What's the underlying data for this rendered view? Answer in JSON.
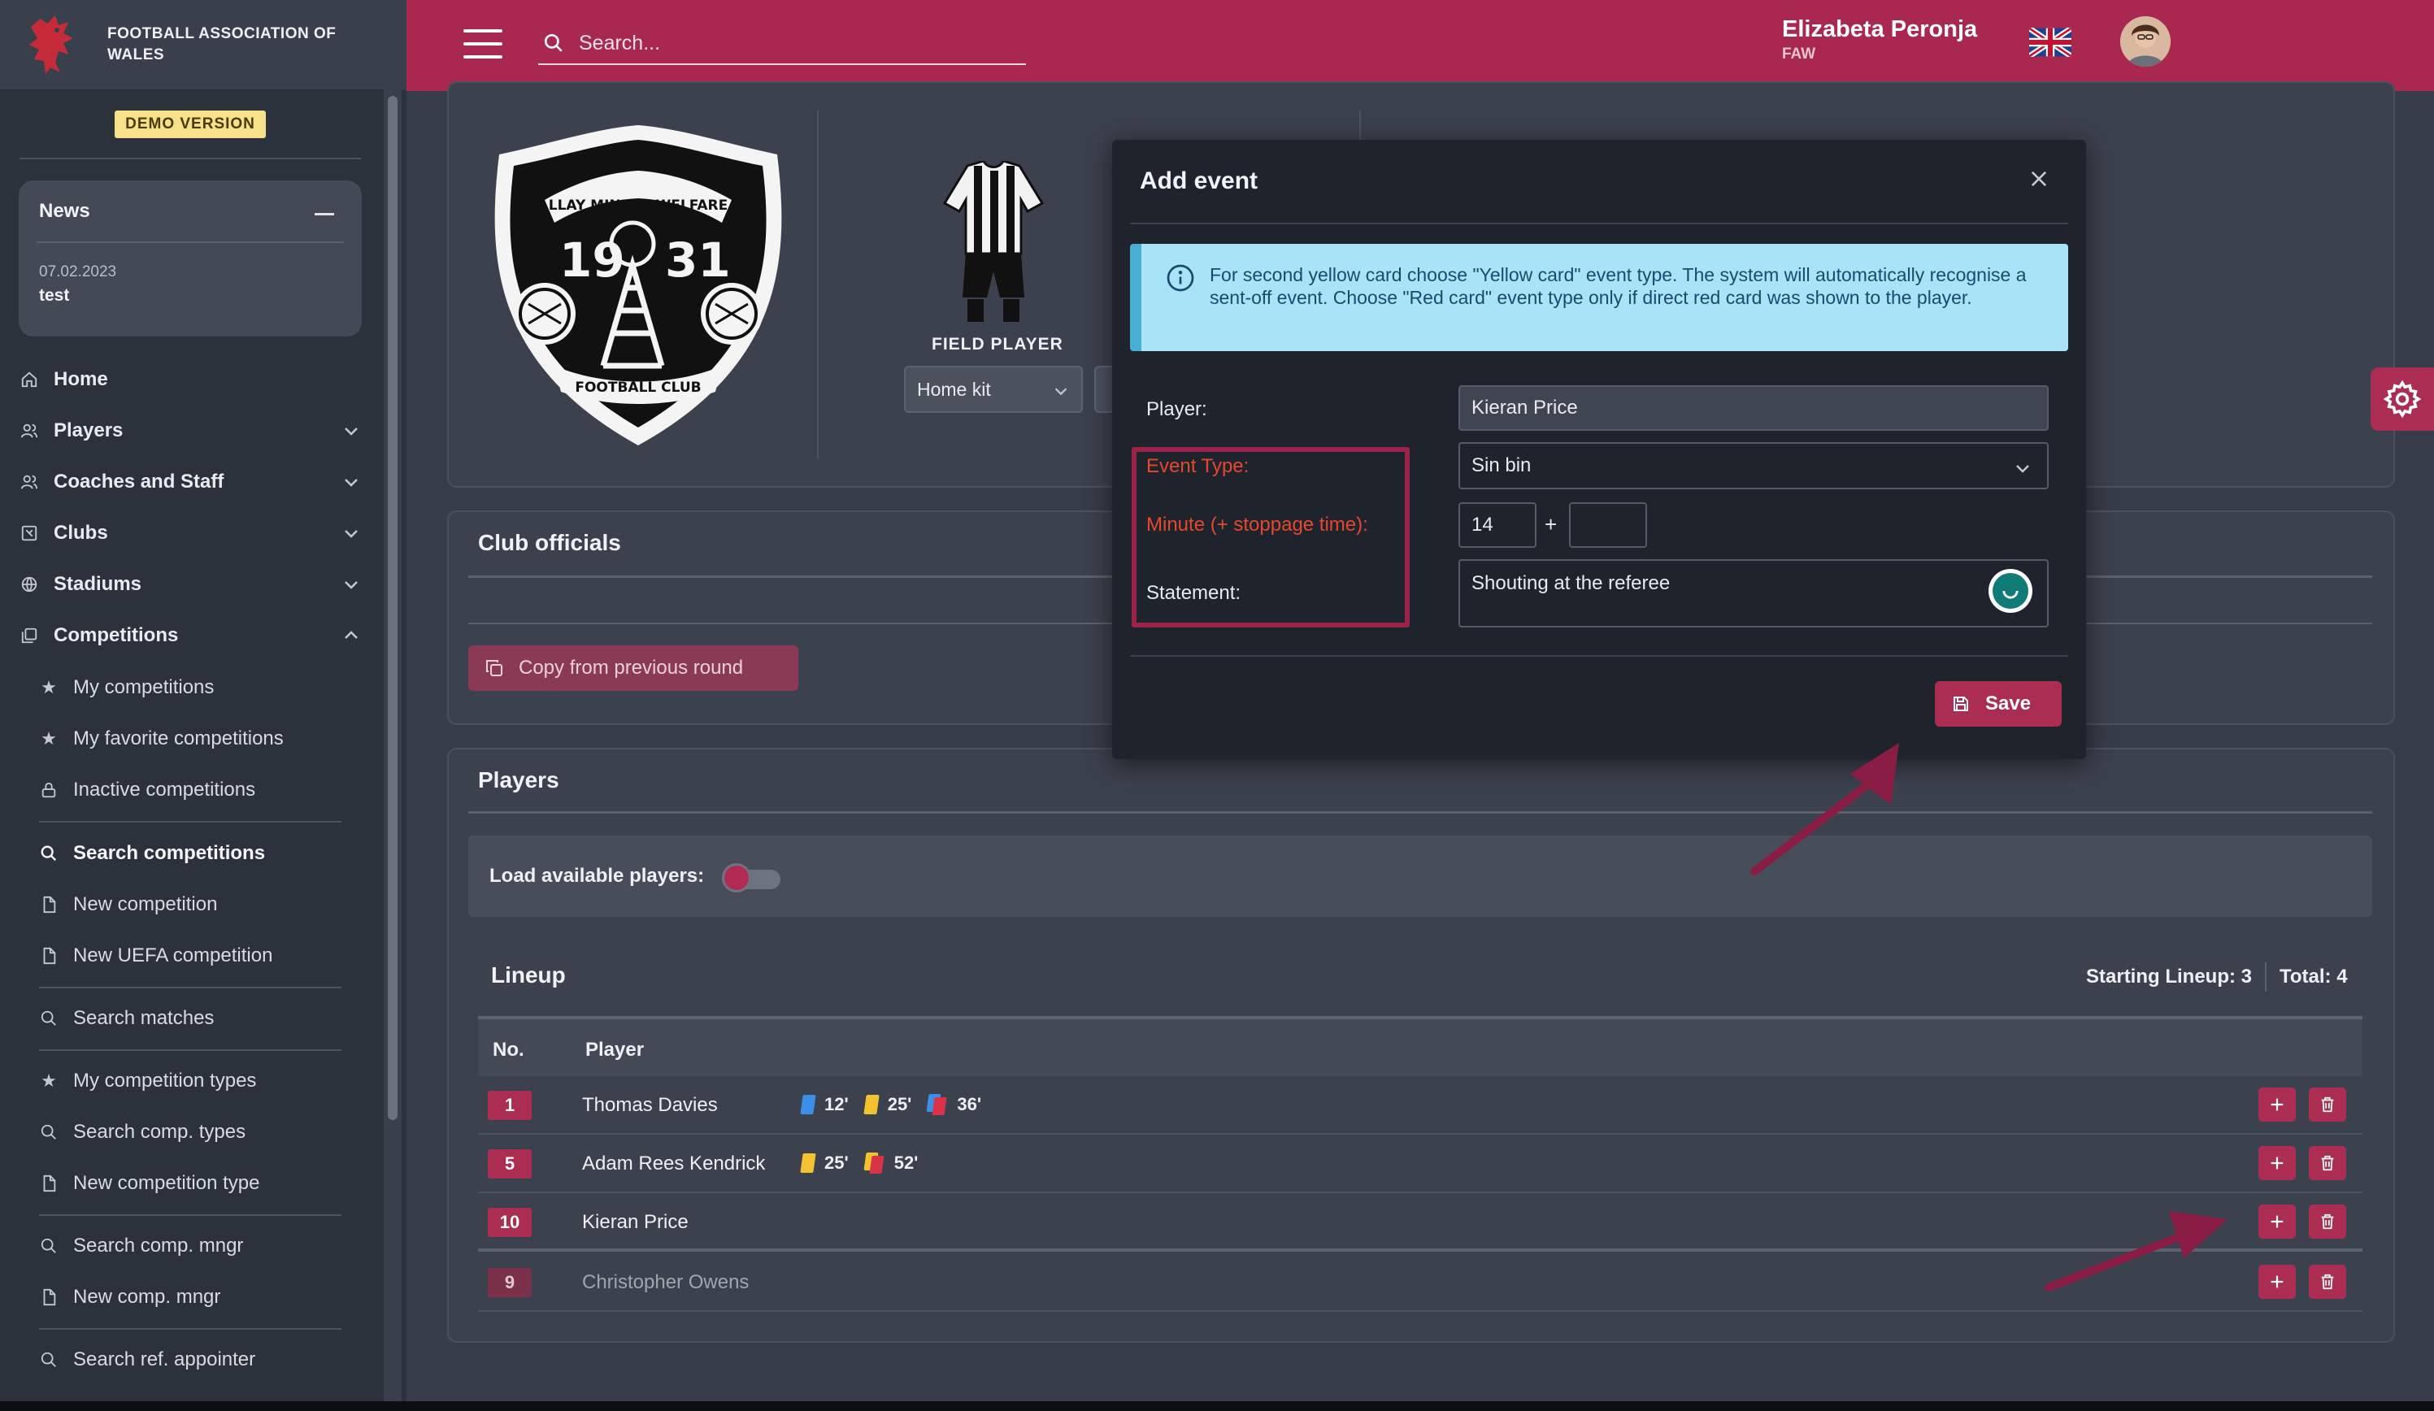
{
  "brand": {
    "name": "FOOTBALL ASSOCIATION OF WALES",
    "demo_badge": "DEMO VERSION",
    "logo_icon": "dragon-icon"
  },
  "news": {
    "title": "News",
    "date": "07.02.2023",
    "text": "test"
  },
  "sidebar": {
    "items": [
      {
        "label": "Home",
        "icon": "home-icon"
      },
      {
        "label": "Players",
        "icon": "players-icon"
      },
      {
        "label": "Coaches and Staff",
        "icon": "staff-icon"
      },
      {
        "label": "Clubs",
        "icon": "clubs-icon"
      },
      {
        "label": "Stadiums",
        "icon": "globe-icon"
      },
      {
        "label": "Competitions",
        "icon": "competitions-icon"
      }
    ],
    "sub_items": [
      {
        "label": "My competitions",
        "icon": "star-icon"
      },
      {
        "label": "My favorite competitions",
        "icon": "star-icon"
      },
      {
        "label": "Inactive competitions",
        "icon": "lock-icon"
      },
      {
        "label": "Search competitions",
        "icon": "search-icon"
      },
      {
        "label": "New competition",
        "icon": "file-icon"
      },
      {
        "label": "New UEFA competition",
        "icon": "file-icon"
      },
      {
        "label": "Search matches",
        "icon": "search-icon"
      },
      {
        "label": "My competition types",
        "icon": "star-icon"
      },
      {
        "label": "Search comp. types",
        "icon": "search-icon"
      },
      {
        "label": "New competition type",
        "icon": "file-icon"
      },
      {
        "label": "Search comp. mngr",
        "icon": "search-icon"
      },
      {
        "label": "New comp. mngr",
        "icon": "file-icon"
      },
      {
        "label": "Search ref. appointer",
        "icon": "search-icon"
      }
    ]
  },
  "topbar": {
    "search_placeholder": "Search...",
    "language_flag": "uk-flag-icon",
    "user_name": "Elizabeta Peronja",
    "user_org": "FAW"
  },
  "club": {
    "logo_text_top": "LLAY MINERS WELFARE",
    "logo_year_left": "19",
    "logo_year_right": "31",
    "logo_text_bottom": "FOOTBALL CLUB",
    "field_player_label": "FIELD PLAYER",
    "kit_select": "Home kit"
  },
  "officials": {
    "title": "Club officials",
    "copy_button": "Copy from previous round"
  },
  "players": {
    "title": "Players",
    "load_label": "Load available players:",
    "lineup_title": "Lineup",
    "starting_lineup": "Starting Lineup: 3",
    "total": "Total: 4",
    "columns": [
      "No.",
      "Player"
    ],
    "rows": [
      {
        "no": "1",
        "name": "Thomas Davies",
        "events": [
          {
            "type": "blue-card",
            "minute": "12'"
          },
          {
            "type": "yellow-card",
            "minute": "25'"
          },
          {
            "type": "second-yellow-red",
            "minute": "36'"
          }
        ]
      },
      {
        "no": "5",
        "name": "Adam Rees Kendrick",
        "events": [
          {
            "type": "yellow-card",
            "minute": "25'"
          },
          {
            "type": "second-yellow-red",
            "minute": "52'"
          }
        ]
      },
      {
        "no": "10",
        "name": "Kieran Price",
        "events": []
      },
      {
        "no": "9",
        "name": "Christopher Owens",
        "events": []
      }
    ]
  },
  "modal": {
    "title": "Add event",
    "info": "For second yellow card choose \"Yellow card\" event type. The system will automatically recognise a sent-off event. Choose \"Red card\" event type only if direct red card was shown to the player.",
    "player_label": "Player:",
    "player_value": "Kieran Price",
    "event_type_label": "Event Type:",
    "event_type_value": "Sin bin",
    "minute_label": "Minute (+ stoppage time):",
    "minute_value": "14",
    "stoppage_value": "",
    "statement_label": "Statement:",
    "statement_value": "Shouting at the referee",
    "save_button": "Save"
  },
  "colors": {
    "brand": "#a8284f",
    "accent_button": "#ab2d52",
    "info_bg": "#a8e3f7",
    "warning_label": "#e8472f",
    "blue_card": "#3b8fe6",
    "yellow_card": "#f2c230",
    "red_card": "#d9334a"
  }
}
